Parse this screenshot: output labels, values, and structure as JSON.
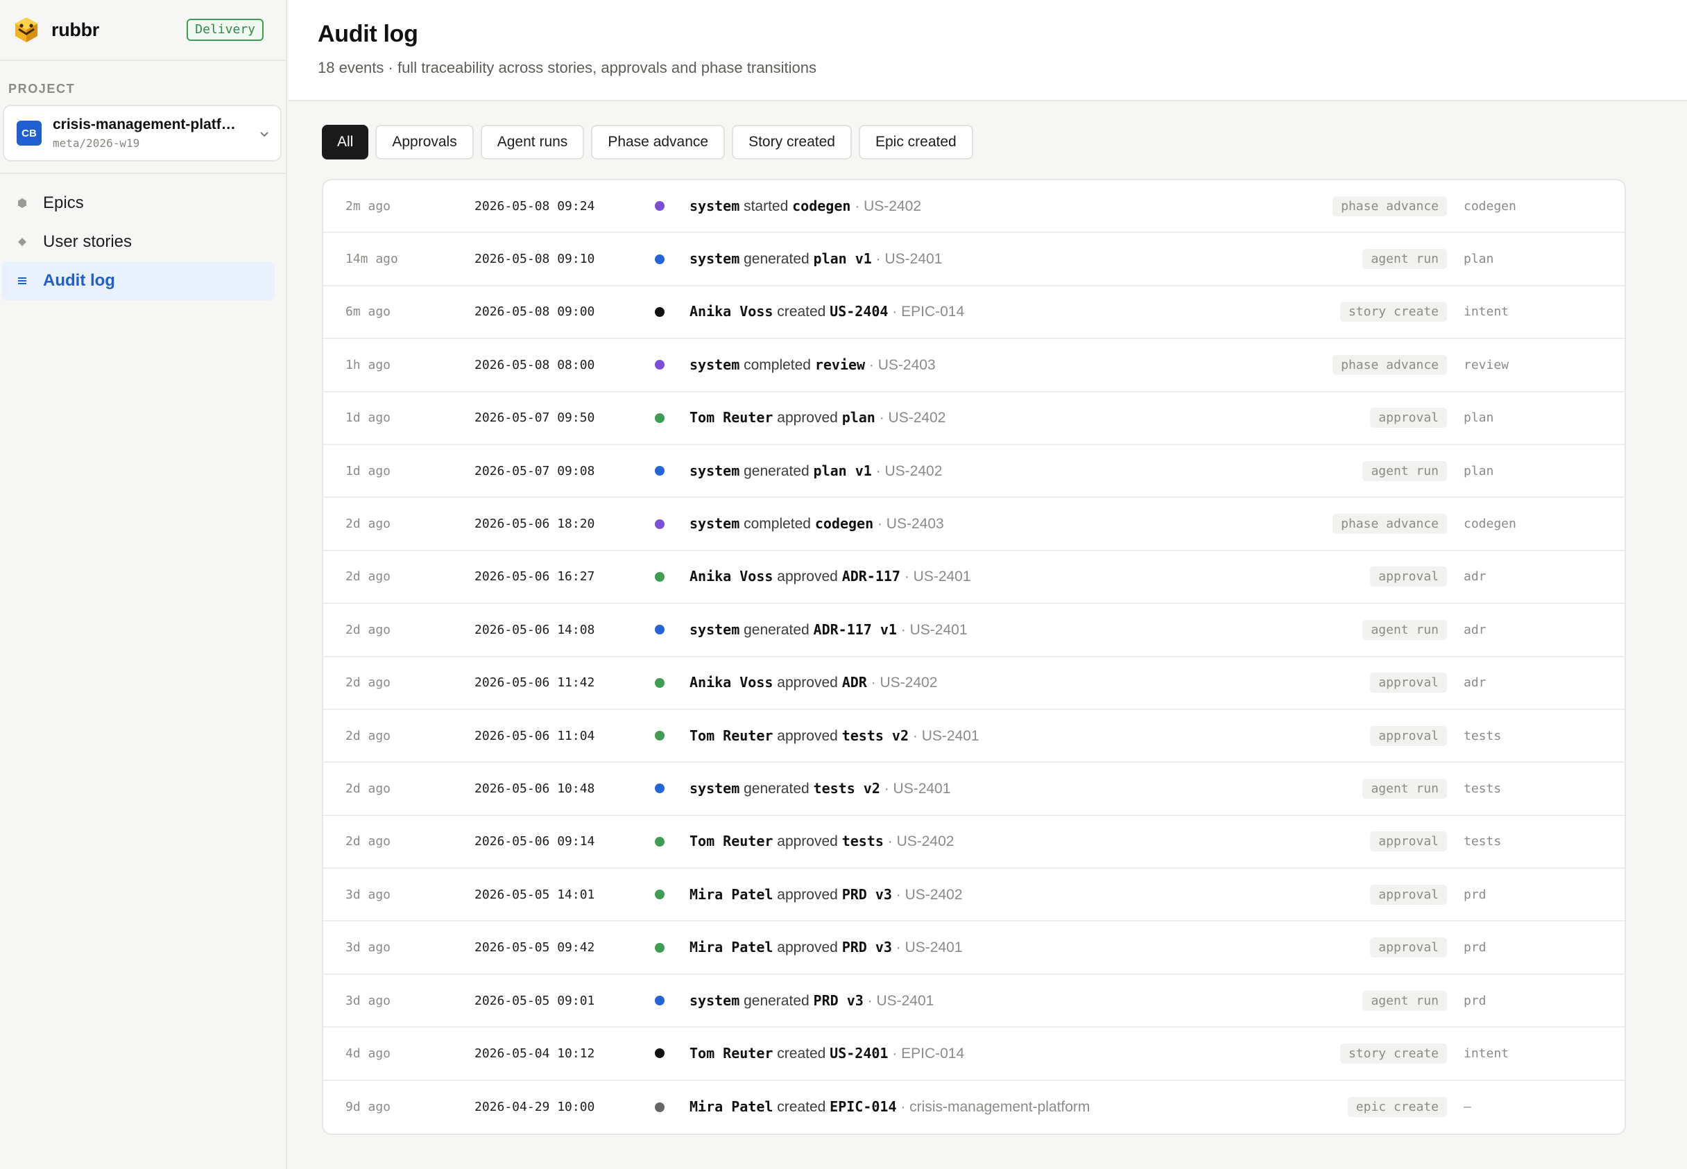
{
  "brand": {
    "name": "rubbr",
    "badge": "Delivery"
  },
  "sidebar": {
    "section_label": "PROJECT",
    "project": {
      "initials": "CB",
      "name": "crisis-management-platf…",
      "sub": "meta/2026-w19"
    },
    "items": [
      {
        "label": "Epics",
        "icon": "hexagon-icon",
        "active": false
      },
      {
        "label": "User stories",
        "icon": "diamond-icon",
        "active": false
      },
      {
        "label": "Audit log",
        "icon": "list-icon",
        "active": true
      }
    ]
  },
  "header": {
    "title": "Audit log",
    "subtitle": "18 events · full traceability across stories, approvals and phase transitions"
  },
  "filters": [
    "All",
    "Approvals",
    "Agent runs",
    "Phase advance",
    "Story created",
    "Epic created"
  ],
  "colors": {
    "phase": "#7b4fd8",
    "agent": "#2563d9",
    "approval": "#3e9d52",
    "story": "#111111",
    "epic": "#666666",
    "accent": "#1f5fd0"
  },
  "events": [
    {
      "rel": "2m ago",
      "ts": "2026-05-08 09:24",
      "kind": "phase",
      "actor": "system",
      "verb": "started",
      "obj": "codegen",
      "ref": "US-2402",
      "type": "phase advance",
      "phase": "codegen"
    },
    {
      "rel": "14m ago",
      "ts": "2026-05-08 09:10",
      "kind": "agent",
      "actor": "system",
      "verb": "generated",
      "obj": "plan v1",
      "ref": "US-2401",
      "type": "agent run",
      "phase": "plan"
    },
    {
      "rel": "6m ago",
      "ts": "2026-05-08 09:00",
      "kind": "story",
      "actor": "Anika Voss",
      "verb": "created",
      "obj": "US-2404",
      "ref": "EPIC-014",
      "type": "story create",
      "phase": "intent"
    },
    {
      "rel": "1h ago",
      "ts": "2026-05-08 08:00",
      "kind": "phase",
      "actor": "system",
      "verb": "completed",
      "obj": "review",
      "ref": "US-2403",
      "type": "phase advance",
      "phase": "review"
    },
    {
      "rel": "1d ago",
      "ts": "2026-05-07 09:50",
      "kind": "approval",
      "actor": "Tom Reuter",
      "verb": "approved",
      "obj": "plan",
      "ref": "US-2402",
      "type": "approval",
      "phase": "plan"
    },
    {
      "rel": "1d ago",
      "ts": "2026-05-07 09:08",
      "kind": "agent",
      "actor": "system",
      "verb": "generated",
      "obj": "plan v1",
      "ref": "US-2402",
      "type": "agent run",
      "phase": "plan"
    },
    {
      "rel": "2d ago",
      "ts": "2026-05-06 18:20",
      "kind": "phase",
      "actor": "system",
      "verb": "completed",
      "obj": "codegen",
      "ref": "US-2403",
      "type": "phase advance",
      "phase": "codegen"
    },
    {
      "rel": "2d ago",
      "ts": "2026-05-06 16:27",
      "kind": "approval",
      "actor": "Anika Voss",
      "verb": "approved",
      "obj": "ADR-117",
      "ref": "US-2401",
      "type": "approval",
      "phase": "adr"
    },
    {
      "rel": "2d ago",
      "ts": "2026-05-06 14:08",
      "kind": "agent",
      "actor": "system",
      "verb": "generated",
      "obj": "ADR-117 v1",
      "ref": "US-2401",
      "type": "agent run",
      "phase": "adr"
    },
    {
      "rel": "2d ago",
      "ts": "2026-05-06 11:42",
      "kind": "approval",
      "actor": "Anika Voss",
      "verb": "approved",
      "obj": "ADR",
      "ref": "US-2402",
      "type": "approval",
      "phase": "adr"
    },
    {
      "rel": "2d ago",
      "ts": "2026-05-06 11:04",
      "kind": "approval",
      "actor": "Tom Reuter",
      "verb": "approved",
      "obj": "tests v2",
      "ref": "US-2401",
      "type": "approval",
      "phase": "tests"
    },
    {
      "rel": "2d ago",
      "ts": "2026-05-06 10:48",
      "kind": "agent",
      "actor": "system",
      "verb": "generated",
      "obj": "tests v2",
      "ref": "US-2401",
      "type": "agent run",
      "phase": "tests"
    },
    {
      "rel": "2d ago",
      "ts": "2026-05-06 09:14",
      "kind": "approval",
      "actor": "Tom Reuter",
      "verb": "approved",
      "obj": "tests",
      "ref": "US-2402",
      "type": "approval",
      "phase": "tests"
    },
    {
      "rel": "3d ago",
      "ts": "2026-05-05 14:01",
      "kind": "approval",
      "actor": "Mira Patel",
      "verb": "approved",
      "obj": "PRD v3",
      "ref": "US-2402",
      "type": "approval",
      "phase": "prd"
    },
    {
      "rel": "3d ago",
      "ts": "2026-05-05 09:42",
      "kind": "approval",
      "actor": "Mira Patel",
      "verb": "approved",
      "obj": "PRD v3",
      "ref": "US-2401",
      "type": "approval",
      "phase": "prd"
    },
    {
      "rel": "3d ago",
      "ts": "2026-05-05 09:01",
      "kind": "agent",
      "actor": "system",
      "verb": "generated",
      "obj": "PRD v3",
      "ref": "US-2401",
      "type": "agent run",
      "phase": "prd"
    },
    {
      "rel": "4d ago",
      "ts": "2026-05-04 10:12",
      "kind": "story",
      "actor": "Tom Reuter",
      "verb": "created",
      "obj": "US-2401",
      "ref": "EPIC-014",
      "type": "story create",
      "phase": "intent"
    },
    {
      "rel": "9d ago",
      "ts": "2026-04-29 10:00",
      "kind": "epic",
      "actor": "Mira Patel",
      "verb": "created",
      "obj": "EPIC-014",
      "ref": "crisis-management-platform",
      "type": "epic create",
      "phase": "—"
    }
  ]
}
